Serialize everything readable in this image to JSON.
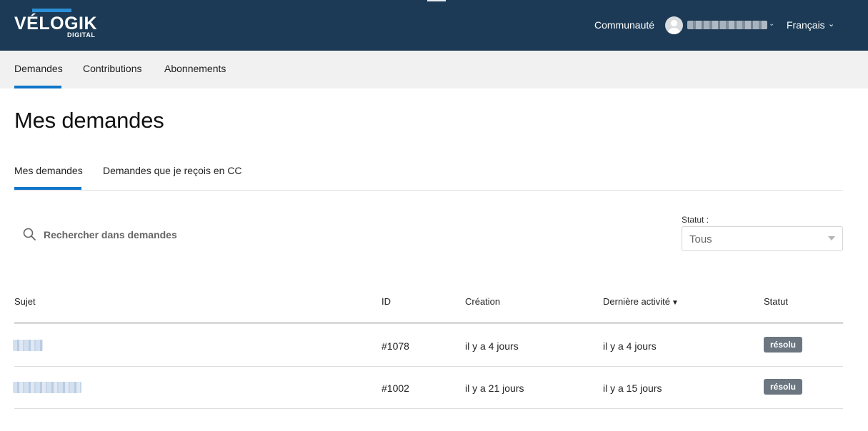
{
  "header": {
    "logo_word": "VÉLOGIK",
    "logo_sub": "DIGITAL",
    "community_link": "Communauté",
    "language": "Français",
    "brand_color": "#1c3a55",
    "accent_color": "#1076c9"
  },
  "subnav": {
    "items": [
      {
        "label": "Demandes",
        "active": true
      },
      {
        "label": "Contributions",
        "active": false
      },
      {
        "label": "Abonnements",
        "active": false
      }
    ]
  },
  "main": {
    "title": "Mes demandes",
    "tabs": [
      {
        "label": "Mes demandes",
        "active": true
      },
      {
        "label": "Demandes que je reçois en CC",
        "active": false
      }
    ],
    "search": {
      "placeholder": "Rechercher dans demandes",
      "icon": "search-icon"
    },
    "status_filter": {
      "label": "Statut :",
      "selected": "Tous"
    },
    "table": {
      "columns": [
        "Sujet",
        "ID",
        "Création",
        "Dernière activité",
        "Statut"
      ],
      "sorted_column_caret": "▼",
      "rows": [
        {
          "id": "#1078",
          "created": "il y a 4 jours",
          "last_activity": "il y a 4 jours",
          "status": "résolu"
        },
        {
          "id": "#1002",
          "created": "il y a 21 jours",
          "last_activity": "il y a 15 jours",
          "status": "résolu"
        }
      ]
    }
  }
}
